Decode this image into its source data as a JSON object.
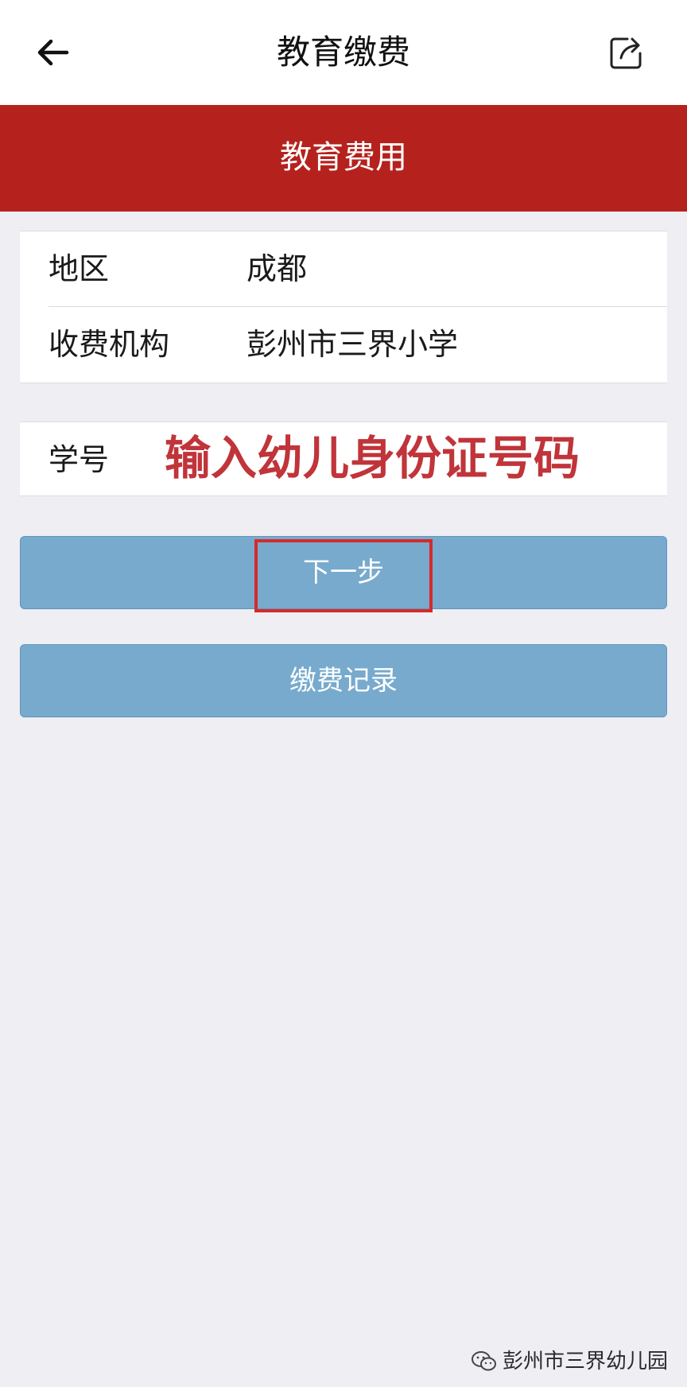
{
  "nav": {
    "title": "教育缴费",
    "back_icon": "arrow-left-icon",
    "share_icon": "share-icon"
  },
  "banner": {
    "title": "教育费用",
    "color": "#b5221d"
  },
  "info": {
    "region_label": "地区",
    "region_value": "成都",
    "institution_label": "收费机构",
    "institution_value": "彭州市三界小学"
  },
  "student": {
    "id_label": "学号",
    "id_hint": "输入幼儿身份证号码",
    "hint_color": "#c0343a"
  },
  "buttons": {
    "next_label": "下一步",
    "records_label": "缴费记录",
    "color": "#77aacd"
  },
  "watermark": {
    "text": "彭州市三界幼儿园",
    "icon": "wechat-icon"
  }
}
